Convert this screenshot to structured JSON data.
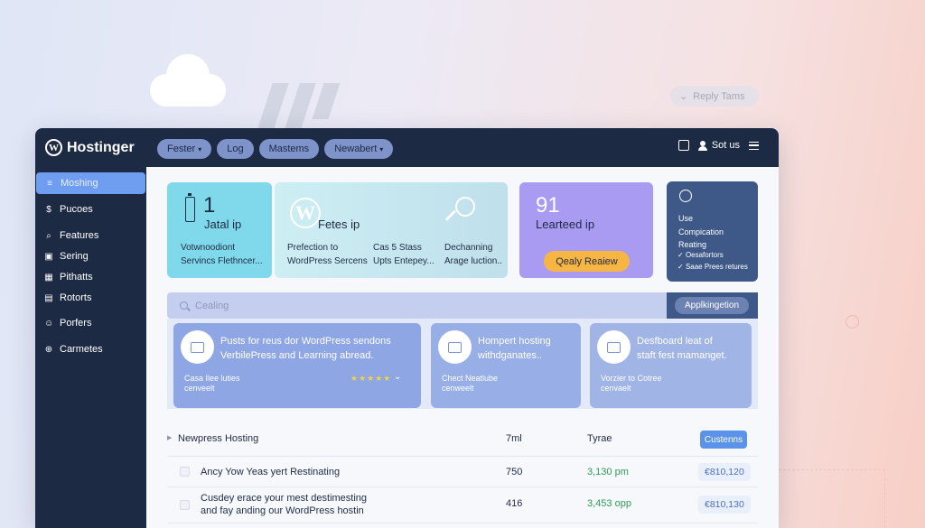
{
  "colors": {
    "topbar": "#1d2a44",
    "accent": "#6f9df0",
    "card_teal": "#7fd9ea",
    "card_purple": "#a99bf2",
    "card_dark": "#3e5987",
    "review_button": "#f7b544",
    "positive_value": "#2e9a57"
  },
  "background": {
    "floating_pill": "Reply Tams"
  },
  "header": {
    "brand": "Hostinger",
    "brand_icon": "wordpress-icon",
    "nav": [
      {
        "label": "Fester",
        "has_dropdown": true
      },
      {
        "label": "Log",
        "has_dropdown": false
      },
      {
        "label": "Mastems",
        "has_dropdown": false
      },
      {
        "label": "Newabert",
        "has_dropdown": true
      }
    ],
    "calendar_icon": "calendar-icon",
    "user_label": "Sot us",
    "menu_icon": "hamburger-icon"
  },
  "sidebar": {
    "items": [
      {
        "label": "Moshing",
        "icon": "list-icon",
        "active": true
      },
      {
        "label": "Pucoes",
        "icon": "dollar-icon",
        "active": false
      },
      {
        "label": "Features",
        "icon": "search-icon",
        "active": false
      },
      {
        "label": "Sering",
        "icon": "card-icon",
        "active": false
      },
      {
        "label": "Pithatts",
        "icon": "grid-icon",
        "active": false
      },
      {
        "label": "Rotorts",
        "icon": "table-icon",
        "active": false
      },
      {
        "label": "Porfers",
        "icon": "users-icon",
        "active": false
      },
      {
        "label": "Carmetes",
        "icon": "lock-icon",
        "active": false
      }
    ]
  },
  "cards": {
    "teal": {
      "number": "1",
      "title": "Jatal ip",
      "line1": "Votwnoodiont",
      "line2": "Servincs Flethncer..."
    },
    "light": {
      "title": "Fetes ip",
      "col1_line1": "Prefection to",
      "col1_line2": "WordPress Sercens",
      "col2_line1": "Cas 5 Stass",
      "col2_line2": "Upts Entepey...",
      "col3_line1": "Dechanning",
      "col3_line2": "Arage luction.."
    },
    "purple": {
      "number": "91",
      "title": "Learteed ip",
      "button": "Qealy Reaiew"
    },
    "dark": {
      "line1": "Use",
      "line2": "Compication",
      "line3": "Reating",
      "list": [
        "Oesafortors",
        "Saae Prees retures"
      ]
    }
  },
  "search": {
    "placeholder": "Cealing",
    "application_chip": "Applkingetion"
  },
  "tiles": [
    {
      "head_line1": "Pusts for reus dor WordPress sendons",
      "head_line2": "VerbilePress and Learning abread.",
      "foot_line1": "Casa Ilee luties",
      "foot_line2": "cenveelt",
      "rating": "★★★★★"
    },
    {
      "head_line1": "Hompert hosting",
      "head_line2": "withdganates..",
      "foot_line1": "Chect Neatlube",
      "foot_line2": "cenweelt"
    },
    {
      "head_line1": "Desfboard leat of",
      "head_line2": "staft fest mamanget.",
      "foot_line1": "Vorzier to Cotree",
      "foot_line2": "cenvaelt"
    }
  ],
  "table": {
    "headers": {
      "name": "Newpress Hosting",
      "col2": "7ml",
      "col3": "Tyrae",
      "action": "Custenns"
    },
    "rows": [
      {
        "name_line1": "Ancy Yow Yeas yert Restinating",
        "name_line2": "",
        "value": "750",
        "stat": "3,130 pm",
        "price": "€810,120"
      },
      {
        "name_line1": "Cusdey erace your mest destimesting",
        "name_line2": "and fay anding our WordPress hostin",
        "value": "416",
        "stat": "3,453 opp",
        "price": "€810,130"
      }
    ]
  }
}
